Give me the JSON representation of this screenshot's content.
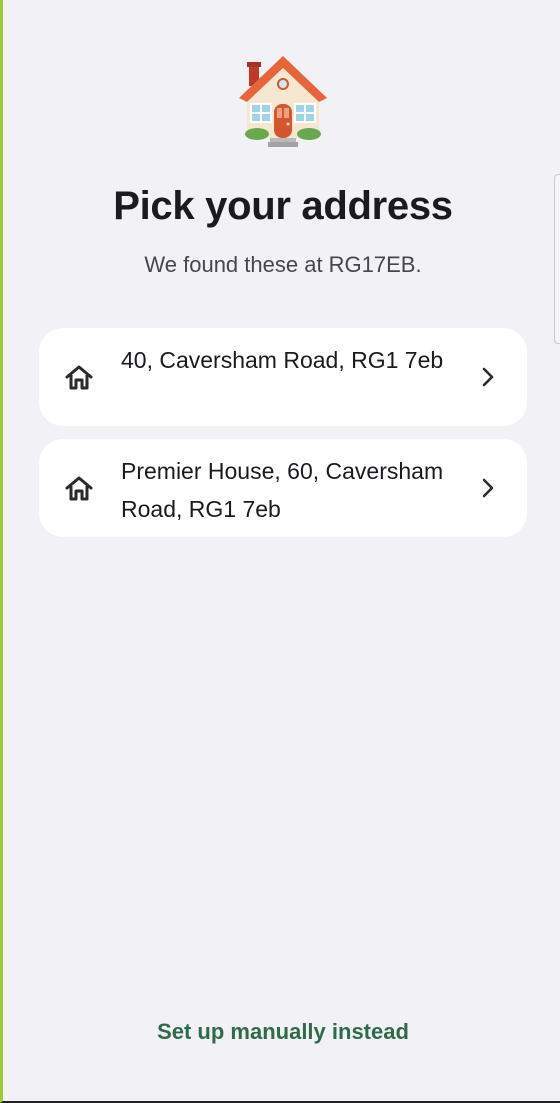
{
  "header": {
    "illustration": "house-icon",
    "title": "Pick your address",
    "subtitle": "We found these at RG17EB."
  },
  "addresses": [
    {
      "icon": "home-outline-icon",
      "label": "40, Caversham Road, RG1 7eb",
      "action_icon": "chevron-right-icon"
    },
    {
      "icon": "home-outline-icon",
      "label": "Premier House, 60, Caversham Road, RG1 7eb",
      "action_icon": "chevron-right-icon"
    }
  ],
  "footer": {
    "manual_label": "Set up manually instead"
  },
  "colors": {
    "background": "#f1f1f6",
    "card": "#ffffff",
    "text_primary": "#1b1b1f",
    "text_secondary": "#45464f",
    "link": "#2f6b4a",
    "roof": "#e8643a",
    "door": "#d2572f"
  }
}
